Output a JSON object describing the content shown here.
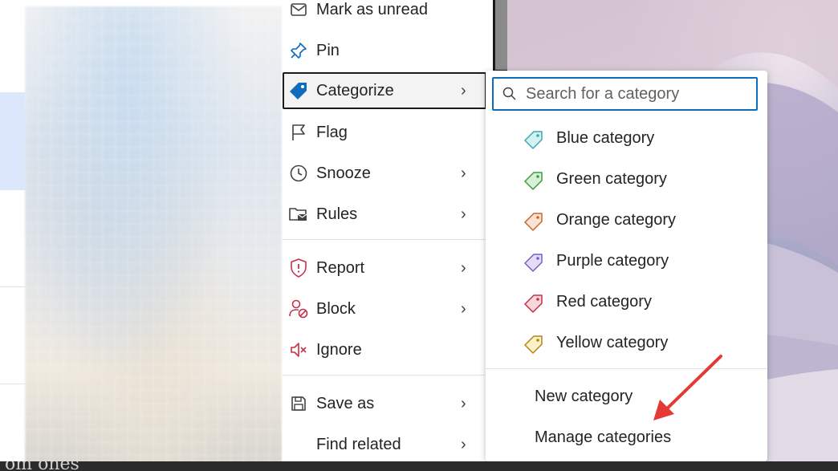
{
  "menu": {
    "items": [
      {
        "label": "Mark as unread",
        "icon": "envelope-icon",
        "submenu": false
      },
      {
        "label": "Pin",
        "icon": "pin-icon",
        "submenu": false
      },
      {
        "label": "Categorize",
        "icon": "tag-icon",
        "submenu": true
      },
      {
        "label": "Flag",
        "icon": "flag-icon",
        "submenu": false
      },
      {
        "label": "Snooze",
        "icon": "clock-icon",
        "submenu": true
      },
      {
        "label": "Rules",
        "icon": "rules-folder-icon",
        "submenu": true
      },
      {
        "label": "Report",
        "icon": "shield-alert-icon",
        "submenu": true
      },
      {
        "label": "Block",
        "icon": "block-person-icon",
        "submenu": true
      },
      {
        "label": "Ignore",
        "icon": "speaker-mute-icon",
        "submenu": false
      },
      {
        "label": "Save as",
        "icon": "save-icon",
        "submenu": true
      },
      {
        "label": "Find related",
        "icon": "",
        "submenu": true
      }
    ],
    "chevron": "›"
  },
  "submenu": {
    "search_placeholder": "Search for a category",
    "categories": [
      {
        "label": "Blue category",
        "color": "#5bc0c9"
      },
      {
        "label": "Green category",
        "color": "#4caf50"
      },
      {
        "label": "Orange category",
        "color": "#e07a3f"
      },
      {
        "label": "Purple category",
        "color": "#8f6fd6"
      },
      {
        "label": "Red category",
        "color": "#d13a4a"
      },
      {
        "label": "Yellow category",
        "color": "#c99a1a"
      }
    ],
    "actions": [
      "New category",
      "Manage categories"
    ]
  },
  "background": {
    "bottom_text": "om ones"
  },
  "colors": {
    "accent": "#0f6cbd",
    "annotation_arrow": "#e53935"
  }
}
